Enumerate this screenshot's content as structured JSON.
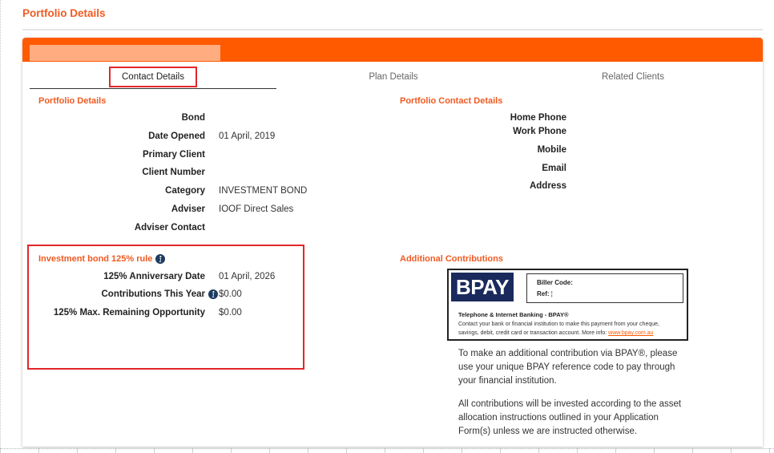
{
  "page": {
    "title": "Portfolio Details"
  },
  "tabs": [
    {
      "label": "Contact Details",
      "active": true
    },
    {
      "label": "Plan Details",
      "active": false
    },
    {
      "label": "Related Clients",
      "active": false
    }
  ],
  "portfolio_details": {
    "heading": "Portfolio Details",
    "rows": [
      {
        "label": "Bond"
      },
      {
        "label": "Date Opened",
        "value": "01 April, 2019"
      },
      {
        "label": "Primary Client"
      },
      {
        "label": "Client Number"
      },
      {
        "label": "Category",
        "value": "INVESTMENT BOND"
      },
      {
        "label": "Adviser",
        "value": "IOOF Direct Sales"
      },
      {
        "label": "Adviser Contact"
      }
    ]
  },
  "contact_details": {
    "heading": "Portfolio Contact Details",
    "rows": [
      {
        "label": "Home Phone"
      },
      {
        "label": "Work Phone"
      },
      {
        "label": "Mobile"
      },
      {
        "label": "Email"
      },
      {
        "label": "Address"
      }
    ]
  },
  "rule_125": {
    "heading": "Investment bond 125% rule",
    "heading_icon": "info-icon",
    "rows": [
      {
        "label": "125% Anniversary Date",
        "value": "01 April, 2026"
      },
      {
        "label": "Contributions This Year",
        "value": "$0.00",
        "icon": "info-icon"
      },
      {
        "label": "125% Max. Remaining Opportunity",
        "value": "$0.00"
      }
    ]
  },
  "contributions": {
    "heading": "Additional Contributions",
    "bpay": {
      "logo_text": "BPAY",
      "biller_code_label": "Biller Code:",
      "ref_label": "Ref:",
      "ref_value": "¦",
      "title": "Telephone & Internet Banking - BPAY®",
      "description": "Contact your bank or financial institution to make this payment from your cheque, savings, debit, credit card or transaction account. More info: ",
      "link": "www.bpay.com.au"
    },
    "paragraphs": [
      "To make an additional contribution via BPAY®, please use your unique BPAY reference code to pay through your financial institution.",
      "All contributions will be invested according to the asset allocation instructions outlined in your Application Form(s) unless we are instructed otherwise."
    ]
  },
  "colors": {
    "accent": "#FF5A00",
    "heading": "#F05A22",
    "info_icon": "#1D3A5F",
    "bpay_navy": "#1B2A5C",
    "highlight": "#E3262B"
  }
}
